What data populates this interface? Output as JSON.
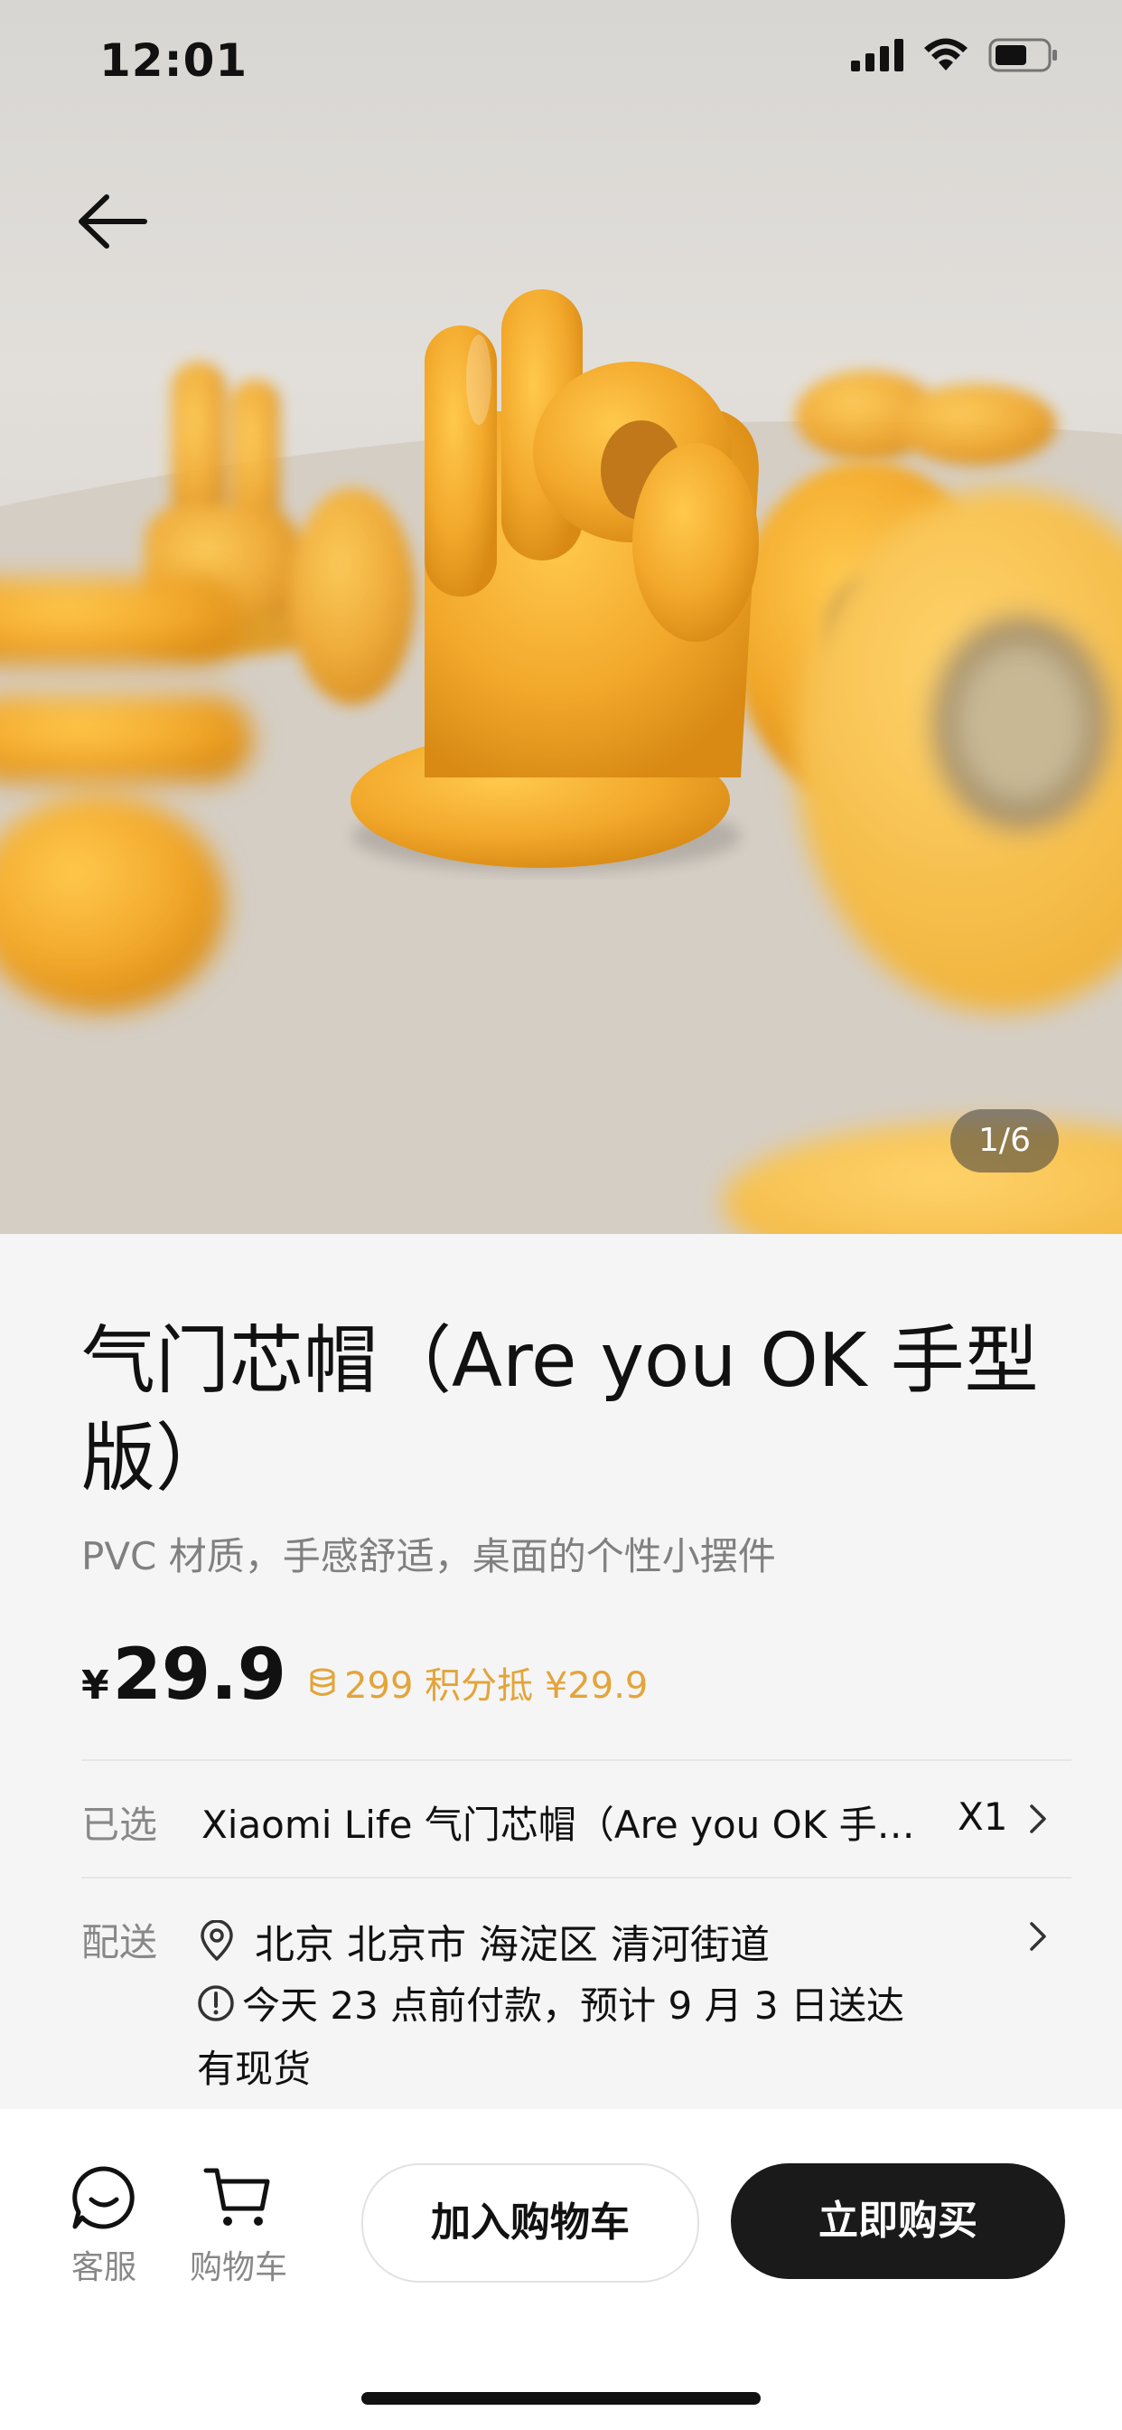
{
  "status_bar": {
    "time": "12:01"
  },
  "hero": {
    "page_indicator": "1/6"
  },
  "product": {
    "title": "气门芯帽（Are you OK 手型版）",
    "subtitle": "PVC 材质，手感舒适，桌面的个性小摆件",
    "currency": "¥",
    "price": "29.9",
    "points_text": "299 积分抵 ¥29.9",
    "accent_color": "#e3a43a"
  },
  "selection": {
    "label": "已选",
    "value": "Xiaomi Life 气门芯帽（Are you OK 手型版）",
    "quantity": "X1"
  },
  "delivery": {
    "label": "配送",
    "address": "北京 北京市 海淀区 清河街道",
    "estimate": "今天 23 点前付款，预计 9 月 3 日送达",
    "stock": "有现货"
  },
  "bottom_bar": {
    "service_label": "客服",
    "cart_label": "购物车",
    "add_to_cart": "加入购物车",
    "buy_now": "立即购买"
  },
  "icons": [
    "back-arrow-icon",
    "signal-icon",
    "wifi-icon",
    "battery-icon",
    "coin-icon",
    "chevron-right-icon",
    "location-pin-icon",
    "info-circle-icon",
    "chat-icon",
    "cart-icon"
  ]
}
